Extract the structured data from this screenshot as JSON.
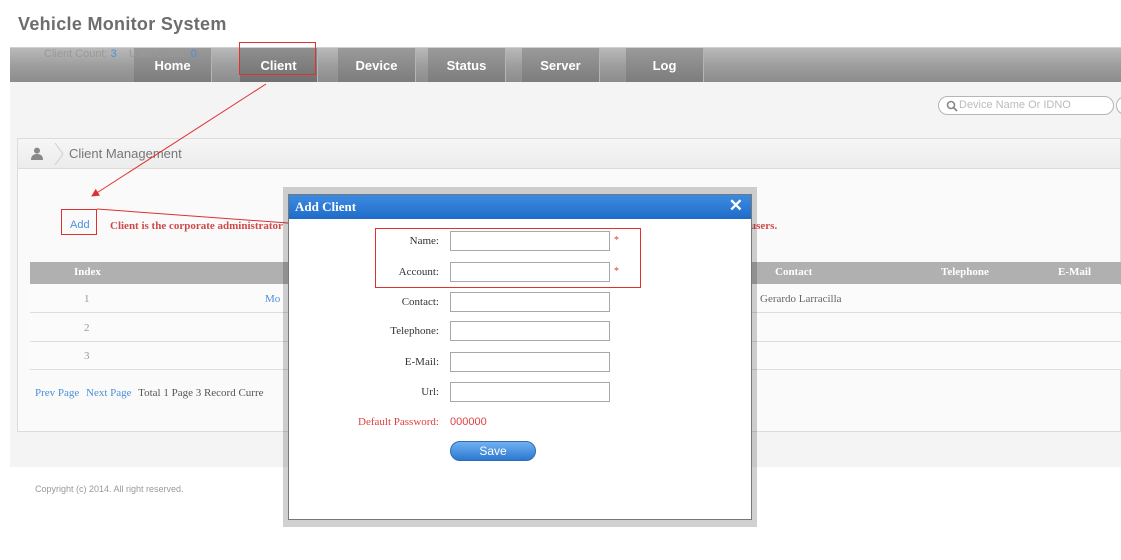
{
  "app": {
    "title": "Vehicle Monitor System"
  },
  "nav": [
    "Home",
    "Client",
    "Device",
    "Status",
    "Server",
    "Log"
  ],
  "search": {
    "placeholder": "Device Name Or IDNO"
  },
  "panel": {
    "title": "Client Management",
    "client_count_label": "Client Count:",
    "client_count": "3",
    "user_count_label": "User Count:",
    "user_count": "0",
    "add_label": "Add",
    "note": "Client is the corporate administrator",
    "note_tail": "users."
  },
  "table": {
    "headers": [
      "Index",
      "Contact",
      "Telephone",
      "E-Mail"
    ],
    "rows": [
      {
        "index": "1",
        "name_partial": "Mo",
        "contact": "Gerardo Larracilla"
      },
      {
        "index": "2",
        "name_partial": "",
        "contact": ""
      },
      {
        "index": "3",
        "name_partial": "",
        "contact": ""
      }
    ]
  },
  "pager": {
    "prev": "Prev Page",
    "next": "Next Page",
    "summary": "Total 1 Page  3 Record  Curre"
  },
  "copyright": "Copyright (c) 2014. All right reserved.",
  "dialog": {
    "title": "Add Client",
    "close": "✕",
    "fields": [
      {
        "label": "Name:",
        "required": "*"
      },
      {
        "label": "Account:",
        "required": "*"
      },
      {
        "label": "Contact:"
      },
      {
        "label": "Telephone:"
      },
      {
        "label": "E-Mail:"
      },
      {
        "label": "Url:"
      }
    ],
    "default_password_label": "Default Password:",
    "default_password": "000000",
    "save": "Save"
  },
  "colors": {
    "accent": "#1f6cc9",
    "annotation": "#e03030",
    "link": "#4a90d9"
  },
  "icons": [
    "search-icon",
    "user-icon",
    "close-icon"
  ]
}
